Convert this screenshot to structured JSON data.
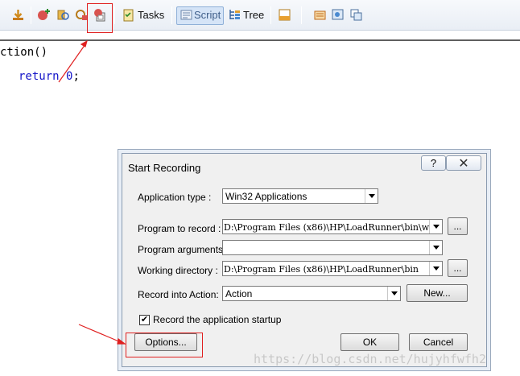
{
  "toolbar": {
    "tasks_label": "Tasks",
    "script_label": "Script",
    "tree_label": "Tree"
  },
  "editor": {
    "line1": "ction()",
    "line2_keyword": "return",
    "line2_value": "0",
    "line2_end": ";"
  },
  "dialog": {
    "title": "Start Recording",
    "help_label": "?",
    "close_label": "✕",
    "application_type_label": "Application type :",
    "application_type_value": "Win32 Applications",
    "program_to_record_label": "Program to record :",
    "program_to_record_value": "D:\\Program Files (x86)\\HP\\LoadRunner\\bin\\w;",
    "program_arguments_label": "Program arguments :",
    "program_arguments_value": "",
    "working_directory_label": "Working directory :",
    "working_directory_value": "D:\\Program Files (x86)\\HP\\LoadRunner\\bin",
    "record_into_action_label": "Record into Action:",
    "record_into_action_value": "Action",
    "browse_label": "...",
    "new_label": "New...",
    "record_startup_label": "Record the application startup",
    "record_startup_checked": true,
    "options_label": "Options...",
    "ok_label": "OK",
    "cancel_label": "Cancel"
  },
  "watermark": "https://blog.csdn.net/hujyhfwfh2",
  "colors": {
    "annotation_red": "#e02020",
    "keyword_blue": "#1414c8"
  }
}
